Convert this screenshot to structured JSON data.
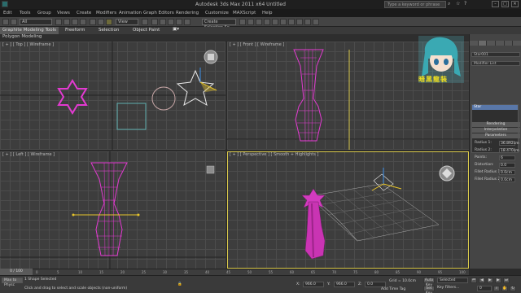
{
  "titlebar": {
    "title": "Autodesk 3ds Max  2011 x64    Untitled",
    "search_placeholder": "Type a keyword or phrase",
    "min": "–",
    "max": "□",
    "close": "✕"
  },
  "menu": [
    "Edit",
    "Tools",
    "Group",
    "Views",
    "Create",
    "Modifiers",
    "Animation",
    "Graph Editors",
    "Rendering",
    "Customize",
    "MAXScript",
    "Help"
  ],
  "toolbar": {
    "filter_label": "All",
    "view_label": "View",
    "selection_set_label": "Create Selection Se"
  },
  "ribbon": {
    "tabs": [
      "Graphite Modeling Tools",
      "Freeform",
      "Selection",
      "Object Paint"
    ],
    "sub": "Polygon Modeling"
  },
  "viewports": {
    "top": "[ + ] [ Top ] [ Wireframe ]",
    "front": "[ + ] [ Front ] [ Wireframe ]",
    "left": "[ + ] [ Left ] [ Wireframe ]",
    "perspective": "[ + ] [ Perspective ] [ Smooth + Highlights ]"
  },
  "watermark": "暗黑龍裝",
  "command_panel": {
    "object_name": "Star001",
    "modifier_list": "Modifier List",
    "stack_item": "Star",
    "rollouts": [
      "Rendering",
      "Interpolation",
      "Parameters"
    ],
    "params": [
      {
        "label": "Radius 1:",
        "value": "36.892cm"
      },
      {
        "label": "Radius 2:",
        "value": "18.470cm"
      },
      {
        "label": "Points:",
        "value": "6"
      },
      {
        "label": "Distortion:",
        "value": "0.0"
      },
      {
        "label": "Fillet Radius 1:",
        "value": "0.0cm"
      },
      {
        "label": "Fillet Radius 2:",
        "value": "0.0cm"
      }
    ]
  },
  "timeline": {
    "slider": "0 / 100",
    "ticks": [
      "0",
      "5",
      "10",
      "15",
      "20",
      "25",
      "30",
      "35",
      "40",
      "45",
      "50",
      "55",
      "60",
      "65",
      "70",
      "75",
      "80",
      "85",
      "90",
      "95",
      "100"
    ]
  },
  "status": {
    "left": "Max to Physc",
    "selected": "1 Shape Selected",
    "prompt": "Click and drag to select and scale objects (non-uniform)",
    "x_label": "X:",
    "x_value": "966.0",
    "y_label": "Y:",
    "y_value": "966.0",
    "z_label": "Z:",
    "z_value": "0.0",
    "grid": "Grid = 10.0cm",
    "add_time_tag": "Add Time Tag",
    "auto_key": "Auto Key",
    "set_key": "Set Key",
    "key_filters": "Key Filters...",
    "selected_dropdown": "Selected",
    "frame": "0"
  }
}
